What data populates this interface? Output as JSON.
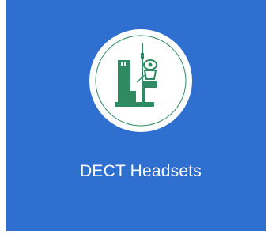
{
  "tile": {
    "label": "DECT Headsets",
    "icon": "dect-headset-base-icon",
    "background_color": "#2f6fd0",
    "icon_color": "#2e8a60"
  }
}
